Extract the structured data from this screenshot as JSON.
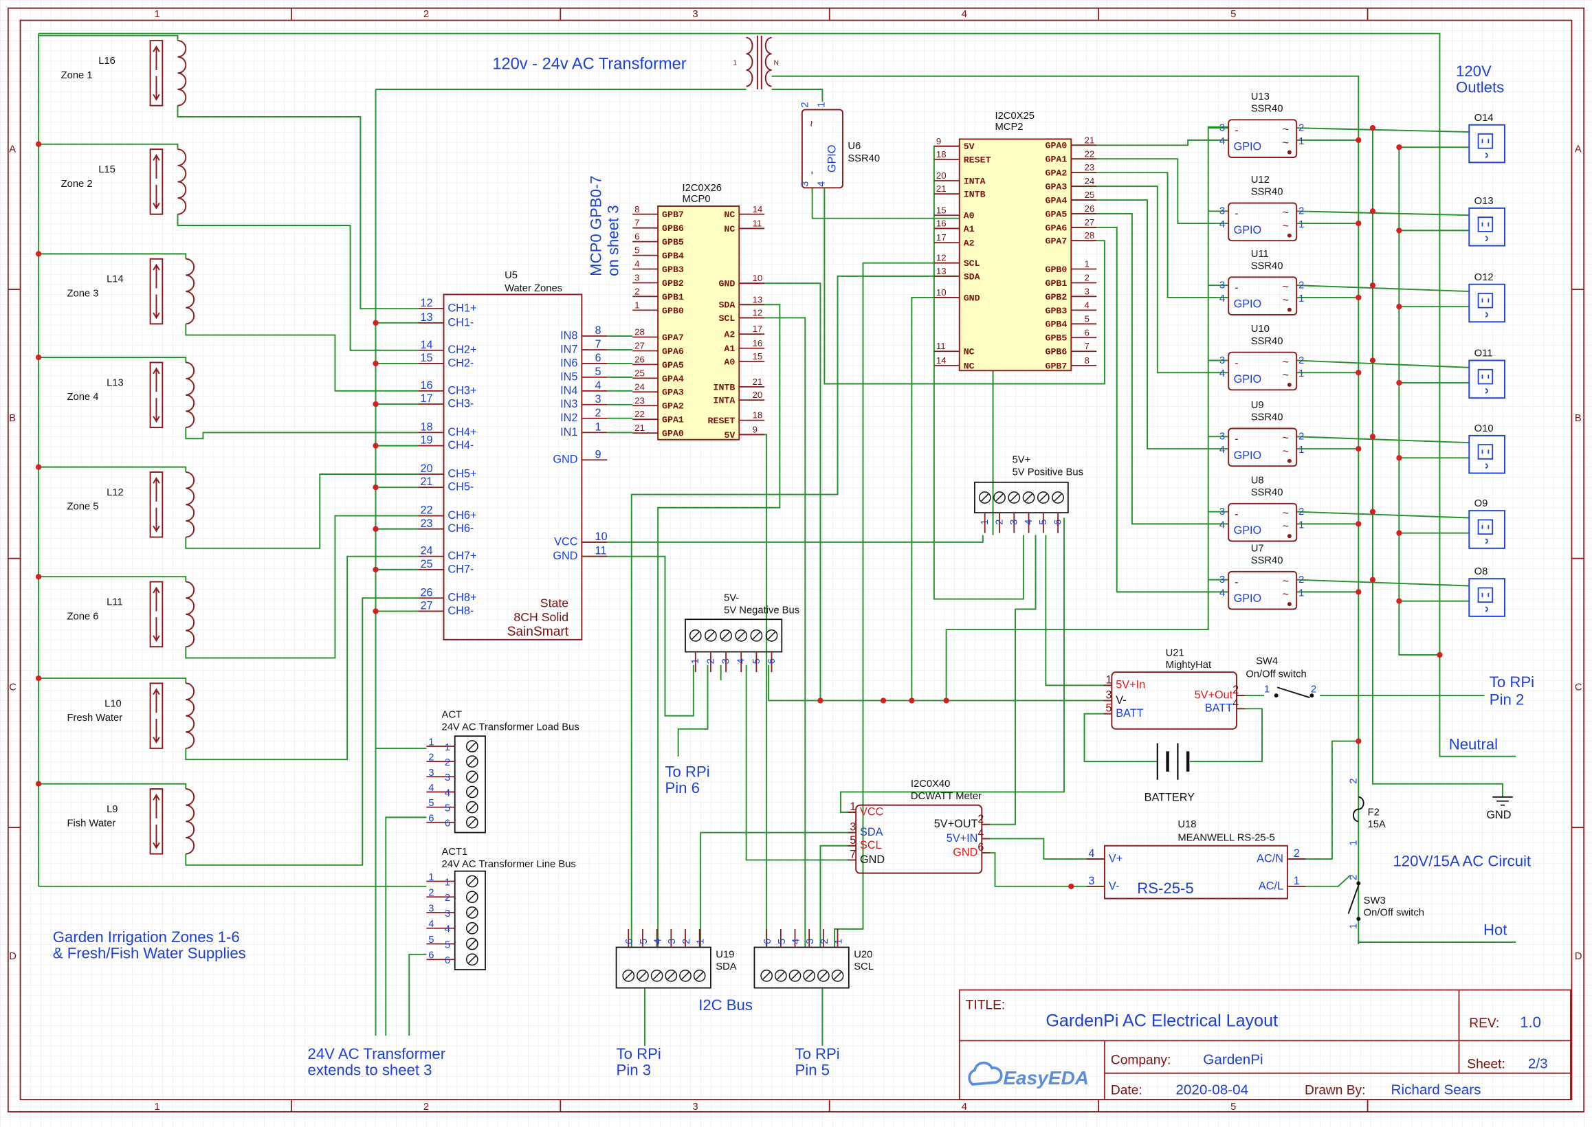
{
  "frame": {
    "columns": [
      "1",
      "2",
      "3",
      "4",
      "5"
    ],
    "rows": [
      "A",
      "B",
      "C",
      "D"
    ]
  },
  "title_block": {
    "title_label": "TITLE:",
    "title": "GardenPi AC Electrical Layout",
    "rev_label": "REV:",
    "rev": "1.0",
    "company_label": "Company:",
    "company": "GardenPi",
    "sheet_label": "Sheet:",
    "sheet": "2/3",
    "date_label": "Date:",
    "date": "2020-08-04",
    "drawn_label": "Drawn By:",
    "drawn_by": "Richard Sears",
    "logo": "EasyEDA"
  },
  "annotations": {
    "transformer": "120v - 24v AC Transformer",
    "mcp0_note_1": "MCP0 GPB0-7",
    "mcp0_note_2": "on sheet 3",
    "outlets_1": "120V",
    "outlets_2": "Outlets",
    "rpi2_1": "To RPi",
    "rpi2_2": "Pin 2",
    "neutral": "Neutral",
    "ac_circuit": "120V/15A AC Circuit",
    "hot": "Hot",
    "rpi6_1": "To RPi",
    "rpi6_2": "Pin 6",
    "i2c_bus": "I2C Bus",
    "rpi3_1": "To RPi",
    "rpi3_2": "Pin 3",
    "rpi5_1": "To RPi",
    "rpi5_2": "Pin 5",
    "ext_1": "24V AC Transformer",
    "ext_2": "extends to sheet 3",
    "garden_1": "Garden Irrigation Zones 1-6",
    "garden_2": "& Fresh/Fish Water Supplies"
  },
  "transformer": {
    "pin_primary": "1",
    "pin_secondary": "N"
  },
  "zones": [
    {
      "ref": "L16",
      "label": "Zone 1"
    },
    {
      "ref": "L15",
      "label": "Zone 2"
    },
    {
      "ref": "L14",
      "label": "Zone 3"
    },
    {
      "ref": "L13",
      "label": "Zone 4"
    },
    {
      "ref": "L12",
      "label": "Zone 5"
    },
    {
      "ref": "L11",
      "label": "Zone 6"
    },
    {
      "ref": "L10",
      "label": "Fresh Water"
    },
    {
      "ref": "L9",
      "label": "Fish Water"
    }
  ],
  "u5": {
    "ref": "U5",
    "name": "Water Zones",
    "left_pins": [
      {
        "num": "12",
        "name": "CH1+"
      },
      {
        "num": "13",
        "name": "CH1-"
      },
      {
        "num": "14",
        "name": "CH2+"
      },
      {
        "num": "15",
        "name": "CH2-"
      },
      {
        "num": "16",
        "name": "CH3+"
      },
      {
        "num": "17",
        "name": "CH3-"
      },
      {
        "num": "18",
        "name": "CH4+"
      },
      {
        "num": "19",
        "name": "CH4-"
      },
      {
        "num": "20",
        "name": "CH5+"
      },
      {
        "num": "21",
        "name": "CH5-"
      },
      {
        "num": "22",
        "name": "CH6+"
      },
      {
        "num": "23",
        "name": "CH6-"
      },
      {
        "num": "24",
        "name": "CH7+"
      },
      {
        "num": "25",
        "name": "CH7-"
      },
      {
        "num": "26",
        "name": "CH8+"
      },
      {
        "num": "27",
        "name": "CH8-"
      }
    ],
    "right_pins": [
      {
        "num": "8",
        "name": "IN8"
      },
      {
        "num": "7",
        "name": "IN7"
      },
      {
        "num": "6",
        "name": "IN6"
      },
      {
        "num": "5",
        "name": "IN5"
      },
      {
        "num": "4",
        "name": "IN4"
      },
      {
        "num": "3",
        "name": "IN3"
      },
      {
        "num": "2",
        "name": "IN2"
      },
      {
        "num": "1",
        "name": "IN1"
      },
      {
        "num": "9",
        "name": "GND"
      },
      {
        "num": "10",
        "name": "VCC"
      },
      {
        "num": "11",
        "name": "GND"
      }
    ],
    "footer": [
      "State",
      "8CH Solid",
      "SainSmart"
    ]
  },
  "mcp0": {
    "part": "I2C0X26",
    "ref": "MCP0",
    "left_pins": [
      {
        "num": "8",
        "name": "GPB7"
      },
      {
        "num": "7",
        "name": "GPB6"
      },
      {
        "num": "6",
        "name": "GPB5"
      },
      {
        "num": "5",
        "name": "GPB4"
      },
      {
        "num": "4",
        "name": "GPB3"
      },
      {
        "num": "3",
        "name": "GPB2"
      },
      {
        "num": "2",
        "name": "GPB1"
      },
      {
        "num": "1",
        "name": "GPB0"
      },
      {
        "num": "28",
        "name": "GPA7"
      },
      {
        "num": "27",
        "name": "GPA6"
      },
      {
        "num": "26",
        "name": "GPA5"
      },
      {
        "num": "25",
        "name": "GPA4"
      },
      {
        "num": "24",
        "name": "GPA3"
      },
      {
        "num": "23",
        "name": "GPA2"
      },
      {
        "num": "22",
        "name": "GPA1"
      },
      {
        "num": "21",
        "name": "GPA0"
      }
    ],
    "right_pins": [
      {
        "num": "14",
        "name": "NC"
      },
      {
        "num": "11",
        "name": "NC"
      },
      {
        "num": "10",
        "name": "GND"
      },
      {
        "num": "13",
        "name": "SDA"
      },
      {
        "num": "12",
        "name": "SCL"
      },
      {
        "num": "17",
        "name": "A2"
      },
      {
        "num": "16",
        "name": "A1"
      },
      {
        "num": "15",
        "name": "A0"
      },
      {
        "num": "21",
        "name": "INTB"
      },
      {
        "num": "20",
        "name": "INTA"
      },
      {
        "num": "18",
        "name": "RESET"
      },
      {
        "num": "9",
        "name": "5V"
      }
    ]
  },
  "mcp2": {
    "part": "I2C0X25",
    "ref": "MCP2",
    "left_pins": [
      {
        "num": "9",
        "name": "5V"
      },
      {
        "num": "18",
        "name": "RESET"
      },
      {
        "num": "20",
        "name": "INTA"
      },
      {
        "num": "21",
        "name": "INTB"
      },
      {
        "num": "15",
        "name": "A0"
      },
      {
        "num": "16",
        "name": "A1"
      },
      {
        "num": "17",
        "name": "A2"
      },
      {
        "num": "12",
        "name": "SCL"
      },
      {
        "num": "13",
        "name": "SDA"
      },
      {
        "num": "10",
        "name": "GND"
      },
      {
        "num": "11",
        "name": "NC"
      },
      {
        "num": "14",
        "name": "NC"
      }
    ],
    "right_pins": [
      {
        "num": "21",
        "name": "GPA0"
      },
      {
        "num": "22",
        "name": "GPA1"
      },
      {
        "num": "23",
        "name": "GPA2"
      },
      {
        "num": "24",
        "name": "GPA3"
      },
      {
        "num": "25",
        "name": "GPA4"
      },
      {
        "num": "26",
        "name": "GPA5"
      },
      {
        "num": "27",
        "name": "GPA6"
      },
      {
        "num": "28",
        "name": "GPA7"
      },
      {
        "num": "1",
        "name": "GPB0"
      },
      {
        "num": "2",
        "name": "GPB1"
      },
      {
        "num": "3",
        "name": "GPB2"
      },
      {
        "num": "4",
        "name": "GPB3"
      },
      {
        "num": "5",
        "name": "GPB4"
      },
      {
        "num": "6",
        "name": "GPB5"
      },
      {
        "num": "7",
        "name": "GPB6"
      },
      {
        "num": "8",
        "name": "GPB7"
      }
    ]
  },
  "u6": {
    "ref": "U6",
    "part": "SSR40",
    "label": "GPIO",
    "minus": "-",
    "tilde": "~",
    "pins": [
      "2",
      "1",
      "3",
      "4"
    ]
  },
  "ssr_common": {
    "label": "GPIO",
    "minus": "-",
    "tilde": "~",
    "pins": [
      "3",
      "4",
      "2",
      "1"
    ]
  },
  "ssrs": [
    {
      "ref": "U13",
      "part": "SSR40"
    },
    {
      "ref": "U12",
      "part": "SSR40"
    },
    {
      "ref": "U11",
      "part": "SSR40"
    },
    {
      "ref": "U10",
      "part": "SSR40"
    },
    {
      "ref": "U9",
      "part": "SSR40"
    },
    {
      "ref": "U8",
      "part": "SSR40"
    },
    {
      "ref": "U7",
      "part": "SSR40"
    }
  ],
  "outlets": [
    "O14",
    "O13",
    "O12",
    "O11",
    "O10",
    "O9",
    "O8"
  ],
  "buses": {
    "pos": {
      "ref": "5V+",
      "name": "5V Positive Bus",
      "pins": [
        "1",
        "2",
        "3",
        "4",
        "5",
        "6"
      ]
    },
    "neg": {
      "ref": "5V-",
      "name": "5V Negative Bus",
      "pins": [
        "1",
        "2",
        "3",
        "4",
        "5",
        "6"
      ]
    },
    "act": {
      "ref": "ACT",
      "name": "24V AC Transformer Load Bus",
      "pins": [
        "1",
        "2",
        "3",
        "4",
        "5",
        "6"
      ],
      "inner": [
        "1",
        "2",
        "3",
        "4",
        "5",
        "6"
      ]
    },
    "act1": {
      "ref": "ACT1",
      "name": "24V AC Transformer Line Bus",
      "pins": [
        "1",
        "2",
        "3",
        "4",
        "5",
        "6"
      ],
      "inner": [
        "1",
        "2",
        "3",
        "4",
        "5",
        "6"
      ]
    },
    "u19": {
      "ref": "U19",
      "name": "SDA",
      "pins": [
        "6",
        "5",
        "4",
        "3",
        "2",
        "1"
      ]
    },
    "u20": {
      "ref": "U20",
      "name": "SCL",
      "pins": [
        "6",
        "5",
        "4",
        "3",
        "2",
        "1"
      ]
    }
  },
  "u21": {
    "ref": "U21",
    "name": "MightyHat",
    "left_pins": [
      {
        "num": "1",
        "name": "5V+In",
        "color": "#e21a1a"
      },
      {
        "num": "3",
        "name": "V-",
        "color": "#111111"
      },
      {
        "num": "5",
        "name": "BATT",
        "color": "#1b3fd8"
      }
    ],
    "right_pins": [
      {
        "num": "2",
        "name": "5V+Out",
        "color": "#e21a1a"
      },
      {
        "num": "4",
        "name": "BATT",
        "color": "#1b3fd8"
      }
    ]
  },
  "battery": {
    "label": "BATTERY"
  },
  "dcwatt": {
    "part": "I2C0X40",
    "name": "DCWATT Meter",
    "left_pins": [
      {
        "num": "1",
        "name": "VCC",
        "color": "#e21a1a"
      },
      {
        "num": "3",
        "name": "SDA",
        "color": "#1b3fd8"
      },
      {
        "num": "5",
        "name": "SCL",
        "color": "#e21a1a"
      },
      {
        "num": "7",
        "name": "GND",
        "color": "#111111"
      }
    ],
    "right_pins": [
      {
        "num": "2",
        "name": "5V+OUT",
        "color": "#111111"
      },
      {
        "num": "4",
        "name": "5V+IN",
        "color": "#1b3fd8"
      },
      {
        "num": "6",
        "name": "GND",
        "color": "#e21a1a"
      }
    ]
  },
  "u18": {
    "ref": "U18",
    "name": "MEANWELL RS-25-5",
    "body": "RS-25-5",
    "left_pins": [
      {
        "num": "4",
        "name": "V+"
      },
      {
        "num": "3",
        "name": "V-"
      }
    ],
    "right_pins": [
      {
        "num": "2",
        "name": "AC/N"
      },
      {
        "num": "1",
        "name": "AC/L"
      }
    ]
  },
  "sw4": {
    "ref": "SW4",
    "name": "On/Off switch",
    "pins": [
      "1",
      "2"
    ]
  },
  "sw3": {
    "ref": "SW3",
    "name": "On/Off switch",
    "pins": [
      "2",
      "1"
    ]
  },
  "f2": {
    "ref": "F2",
    "rating": "15A",
    "pins": [
      "2",
      "1"
    ]
  },
  "gnd": {
    "label": "GND"
  },
  "colors": {
    "wire": "#23902a",
    "part": "#8b1a1a",
    "text_blue": "#1b3fd8",
    "text_red": "#e21a1a",
    "chip_fill": "#ffffc4",
    "junction": "#d42020"
  }
}
